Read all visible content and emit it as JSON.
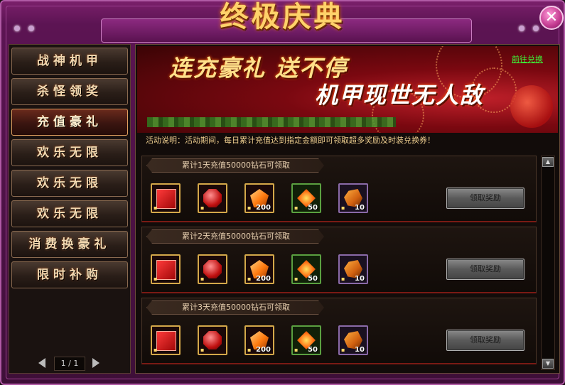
{
  "window": {
    "title": "终极庆典",
    "close_icon": "close-icon",
    "accent_color": "#7a1f6a"
  },
  "sidebar": {
    "items": [
      {
        "label": "战神机甲",
        "active": false
      },
      {
        "label": "杀怪领奖",
        "active": false
      },
      {
        "label": "充值豪礼",
        "active": true
      },
      {
        "label": "欢乐无限",
        "active": false
      },
      {
        "label": "欢乐无限",
        "active": false
      },
      {
        "label": "欢乐无限",
        "active": false
      },
      {
        "label": "消费换豪礼",
        "active": false
      },
      {
        "label": "限时补购",
        "active": false
      }
    ],
    "pager": {
      "text": "1 / 1",
      "prev_icon": "prev-page-icon",
      "next_icon": "next-page-icon"
    }
  },
  "banner": {
    "slogan_top": "连充豪礼 送不停",
    "slogan_bottom": "机甲现世无人敌",
    "link": "前往兑换"
  },
  "description": "活动说明：活动期间，每日累计充值达到指定金额即可领取超多奖励及时装兑换券！",
  "rewards": [
    {
      "title": "累计1天充值50000钻石可领取",
      "button": "领取奖励",
      "items": [
        {
          "icon": "fashion-coupon-icon",
          "qty": ""
        },
        {
          "icon": "red-gem-icon",
          "qty": ""
        },
        {
          "icon": "orange-crystal-icon",
          "qty": "200"
        },
        {
          "icon": "fire-stone-icon",
          "qty": "50"
        },
        {
          "icon": "ore-chunk-icon",
          "qty": "10"
        }
      ]
    },
    {
      "title": "累计2天充值50000钻石可领取",
      "button": "领取奖励",
      "items": [
        {
          "icon": "fashion-coupon-icon",
          "qty": ""
        },
        {
          "icon": "red-gem-icon",
          "qty": ""
        },
        {
          "icon": "orange-crystal-icon",
          "qty": "200"
        },
        {
          "icon": "fire-stone-icon",
          "qty": "50"
        },
        {
          "icon": "ore-chunk-icon",
          "qty": "10"
        }
      ]
    },
    {
      "title": "累计3天充值50000钻石可领取",
      "button": "领取奖励",
      "items": [
        {
          "icon": "fashion-coupon-icon",
          "qty": ""
        },
        {
          "icon": "red-gem-icon",
          "qty": ""
        },
        {
          "icon": "orange-crystal-icon",
          "qty": "200"
        },
        {
          "icon": "fire-stone-icon",
          "qty": "50"
        },
        {
          "icon": "ore-chunk-icon",
          "qty": "10"
        }
      ]
    }
  ],
  "scrollbar": {
    "up_icon": "scroll-up-icon",
    "down_icon": "scroll-down-icon"
  }
}
